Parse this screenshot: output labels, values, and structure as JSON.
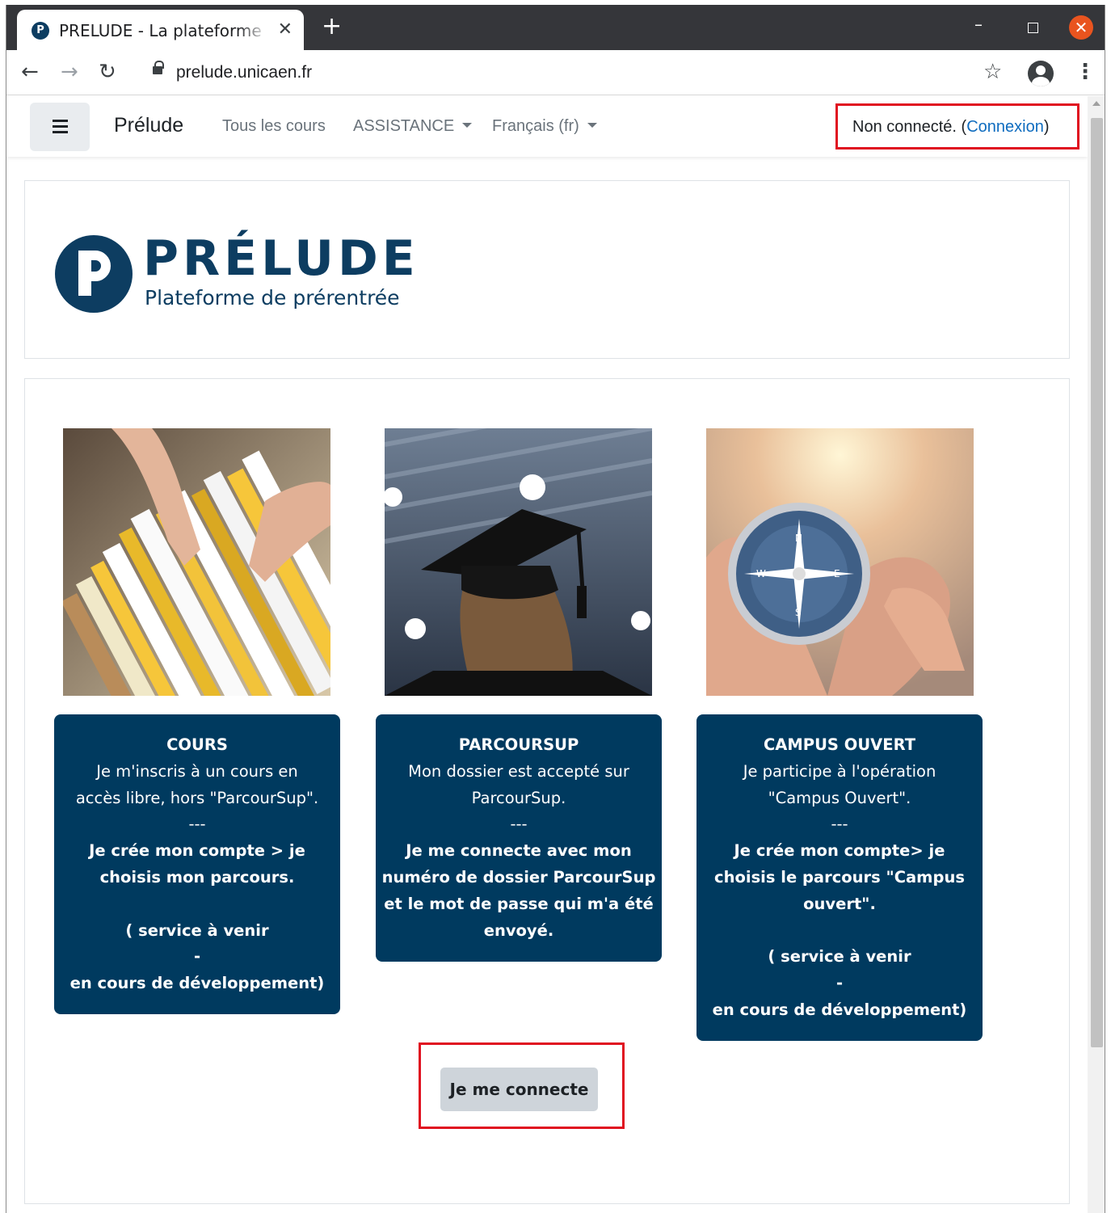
{
  "browser": {
    "tab_title": "PRELUDE - La plateforme",
    "tab_favicon": "P",
    "new_tab": "+",
    "url": "prelude.unicaen.fr"
  },
  "navbar": {
    "brand": "Prélude",
    "links": [
      "Tous les cours",
      "ASSISTANCE",
      "Français (fr)"
    ],
    "login_status": "Non connecté. (",
    "login_link": "Connexion",
    "login_close": ")"
  },
  "logo": {
    "title": "PRÉLUDE",
    "subtitle": "Plateforme de prérentrée"
  },
  "tiles": [
    {
      "title": "COURS",
      "lines": [
        "Je m'inscris à un cours en",
        "accès libre, hors \"ParcourSup\".",
        "---"
      ],
      "bold_lines": [
        "Je crée mon compte  > je",
        "choisis mon parcours.",
        "",
        "( service à venir",
        "-",
        "en cours de développement)"
      ]
    },
    {
      "title": "PARCOURSUP",
      "lines": [
        "Mon dossier est accepté sur",
        "ParcourSup.",
        "---"
      ],
      "bold_lines": [
        "Je me connecte avec mon",
        "numéro de dossier ParcourSup",
        "et le mot de passe qui m'a été",
        "envoyé."
      ]
    },
    {
      "title": "CAMPUS OUVERT",
      "lines": [
        "Je participe à l'opération",
        "\"Campus Ouvert\".",
        "---"
      ],
      "bold_lines": [
        "Je crée mon compte> je",
        "choisis le parcours \"Campus",
        "ouvert\".",
        "",
        "( service à venir",
        "-",
        "en cours de développement)"
      ]
    }
  ],
  "connect_button": "Je me connecte",
  "colors": {
    "brand_navy": "#003a5f",
    "highlight_red": "#e01020",
    "link_blue": "#0f6cbf"
  },
  "icons": [
    "back-arrow-icon",
    "forward-arrow-icon",
    "reload-icon",
    "lock-icon",
    "star-icon",
    "profile-icon",
    "menu-dots-icon",
    "hamburger-icon"
  ]
}
